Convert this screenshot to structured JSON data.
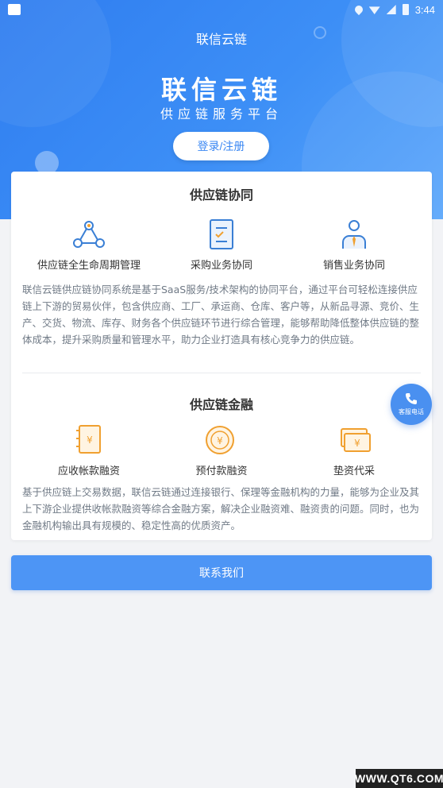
{
  "status_bar": {
    "time": "3:44"
  },
  "header": {
    "nav_title": "联信云链",
    "brand": "联信云链",
    "subtitle": "供应链服务平台",
    "login_button": "登录/注册"
  },
  "collaboration": {
    "title": "供应链协同",
    "features": [
      {
        "label": "供应链全生命周期管理",
        "icon": "network-icon"
      },
      {
        "label": "采购业务协同",
        "icon": "document-list-icon"
      },
      {
        "label": "销售业务协同",
        "icon": "salesperson-icon"
      }
    ],
    "description": "联信云链供应链协同系统是基于SaaS服务/技术架构的协同平台，通过平台可轻松连接供应链上下游的贸易伙伴，包含供应商、工厂、承运商、仓库、客户等，从新品寻源、竞价、生产、交货、物流、库存、财务各个供应链环节进行综合管理，能够帮助降低整体供应链的整体成本，提升采购质量和管理水平，助力企业打造具有核心竞争力的供应链。"
  },
  "finance": {
    "title": "供应链金融",
    "features": [
      {
        "label": "应收帐款融资",
        "icon": "receivable-ledger-icon"
      },
      {
        "label": "预付款融资",
        "icon": "coin-icon"
      },
      {
        "label": "垫资代采",
        "icon": "cash-icon"
      }
    ],
    "description": "基于供应链上交易数据，联信云链通过连接银行、保理等金融机构的力量，能够为企业及其上下游企业提供收帐款融资等综合金融方案，解决企业融资难、融资贵的问题。同时，也为金融机构输出具有规模的、稳定性高的优质资产。"
  },
  "float_button": {
    "label": "客服电话"
  },
  "contact_button": "联系我们",
  "watermark": "WWW.QT6.COM",
  "colors": {
    "primary": "#3a87f3",
    "button": "#4d95f5",
    "icon_blue": "#3a7fd5",
    "icon_orange": "#f0a030"
  }
}
